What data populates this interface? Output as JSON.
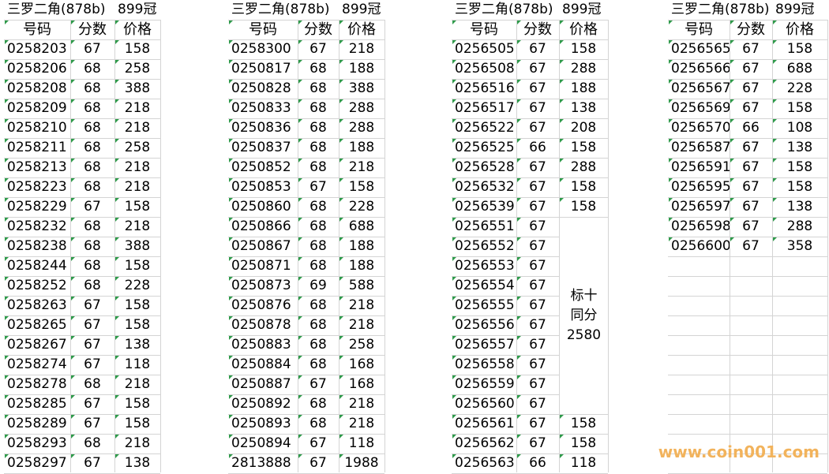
{
  "blocks": [
    {
      "title": "三罗二角(878b)",
      "title_right": "899冠",
      "headers": [
        "号码",
        "分数",
        "价格"
      ],
      "rows": [
        [
          "0258203",
          "67",
          "158"
        ],
        [
          "0258206",
          "68",
          "258"
        ],
        [
          "0258208",
          "68",
          "388"
        ],
        [
          "0258209",
          "68",
          "218"
        ],
        [
          "0258210",
          "68",
          "218"
        ],
        [
          "0258211",
          "68",
          "258"
        ],
        [
          "0258213",
          "68",
          "218"
        ],
        [
          "0258223",
          "68",
          "218"
        ],
        [
          "0258229",
          "67",
          "158"
        ],
        [
          "0258232",
          "68",
          "218"
        ],
        [
          "0258238",
          "68",
          "388"
        ],
        [
          "0258244",
          "68",
          "158"
        ],
        [
          "0258252",
          "68",
          "228"
        ],
        [
          "0258263",
          "67",
          "158"
        ],
        [
          "0258265",
          "67",
          "158"
        ],
        [
          "0258267",
          "67",
          "138"
        ],
        [
          "0258274",
          "67",
          "118"
        ],
        [
          "0258278",
          "68",
          "218"
        ],
        [
          "0258285",
          "67",
          "158"
        ],
        [
          "0258289",
          "67",
          "158"
        ],
        [
          "0258293",
          "68",
          "218"
        ],
        [
          "0258297",
          "67",
          "138"
        ]
      ]
    },
    {
      "title": "三罗二角(878b)",
      "title_right": "899冠",
      "headers": [
        "号码",
        "分数",
        "价格"
      ],
      "rows": [
        [
          "0258300",
          "67",
          "218"
        ],
        [
          "0250817",
          "68",
          "188"
        ],
        [
          "0250828",
          "68",
          "388"
        ],
        [
          "0250833",
          "68",
          "288"
        ],
        [
          "0250836",
          "68",
          "288"
        ],
        [
          "0250837",
          "68",
          "188"
        ],
        [
          "0250852",
          "68",
          "218"
        ],
        [
          "0250853",
          "67",
          "158"
        ],
        [
          "0250860",
          "68",
          "228"
        ],
        [
          "0250866",
          "68",
          "688"
        ],
        [
          "0250867",
          "68",
          "188"
        ],
        [
          "0250871",
          "68",
          "188"
        ],
        [
          "0250873",
          "69",
          "588"
        ],
        [
          "0250876",
          "68",
          "218"
        ],
        [
          "0250878",
          "68",
          "218"
        ],
        [
          "0250883",
          "68",
          "258"
        ],
        [
          "0250884",
          "68",
          "168"
        ],
        [
          "0250887",
          "67",
          "168"
        ],
        [
          "0250892",
          "68",
          "218"
        ],
        [
          "0250893",
          "68",
          "218"
        ],
        [
          "0250894",
          "67",
          "118"
        ],
        [
          "2813888",
          "67",
          "1988"
        ]
      ]
    },
    {
      "title": "三罗二角(878b)",
      "title_right": "899冠",
      "headers": [
        "号码",
        "分数",
        "价格"
      ],
      "merged_note": [
        "标十",
        "同分",
        "2580"
      ],
      "rows": [
        [
          "0256505",
          "67",
          "158"
        ],
        [
          "0256508",
          "67",
          "288"
        ],
        [
          "0256516",
          "67",
          "188"
        ],
        [
          "0256517",
          "67",
          "138"
        ],
        [
          "0256522",
          "67",
          "208"
        ],
        [
          "0256525",
          "66",
          "158"
        ],
        [
          "0256528",
          "67",
          "288"
        ],
        [
          "0256532",
          "67",
          "158"
        ],
        [
          "0256539",
          "67",
          "158"
        ],
        [
          "0256551",
          "67",
          ""
        ],
        [
          "0256552",
          "67",
          ""
        ],
        [
          "0256553",
          "67",
          ""
        ],
        [
          "0256554",
          "67",
          ""
        ],
        [
          "0256555",
          "67",
          ""
        ],
        [
          "0256556",
          "67",
          ""
        ],
        [
          "0256557",
          "67",
          ""
        ],
        [
          "0256558",
          "67",
          ""
        ],
        [
          "0256559",
          "67",
          ""
        ],
        [
          "0256560",
          "67",
          ""
        ],
        [
          "0256561",
          "67",
          "158"
        ],
        [
          "0256562",
          "67",
          "158"
        ],
        [
          "0256563",
          "66",
          "118"
        ]
      ]
    },
    {
      "title": "三罗二角(878b)",
      "title_right": "899冠",
      "headers": [
        "号码",
        "分数",
        "价格"
      ],
      "rows": [
        [
          "0256565",
          "67",
          "158"
        ],
        [
          "0256566",
          "67",
          "688"
        ],
        [
          "0256567",
          "67",
          "228"
        ],
        [
          "0256569",
          "67",
          "158"
        ],
        [
          "0256570",
          "66",
          "108"
        ],
        [
          "0256587",
          "67",
          "138"
        ],
        [
          "0256591",
          "67",
          "158"
        ],
        [
          "0256595",
          "67",
          "158"
        ],
        [
          "0256597",
          "67",
          "138"
        ],
        [
          "0256598",
          "67",
          "288"
        ],
        [
          "0256600",
          "67",
          "358"
        ]
      ]
    }
  ],
  "watermark": "www.coin001.com",
  "colors": {
    "grid": "#d4d4d4",
    "marker": "#2e9a4a",
    "watermark": "#f2b35c"
  }
}
